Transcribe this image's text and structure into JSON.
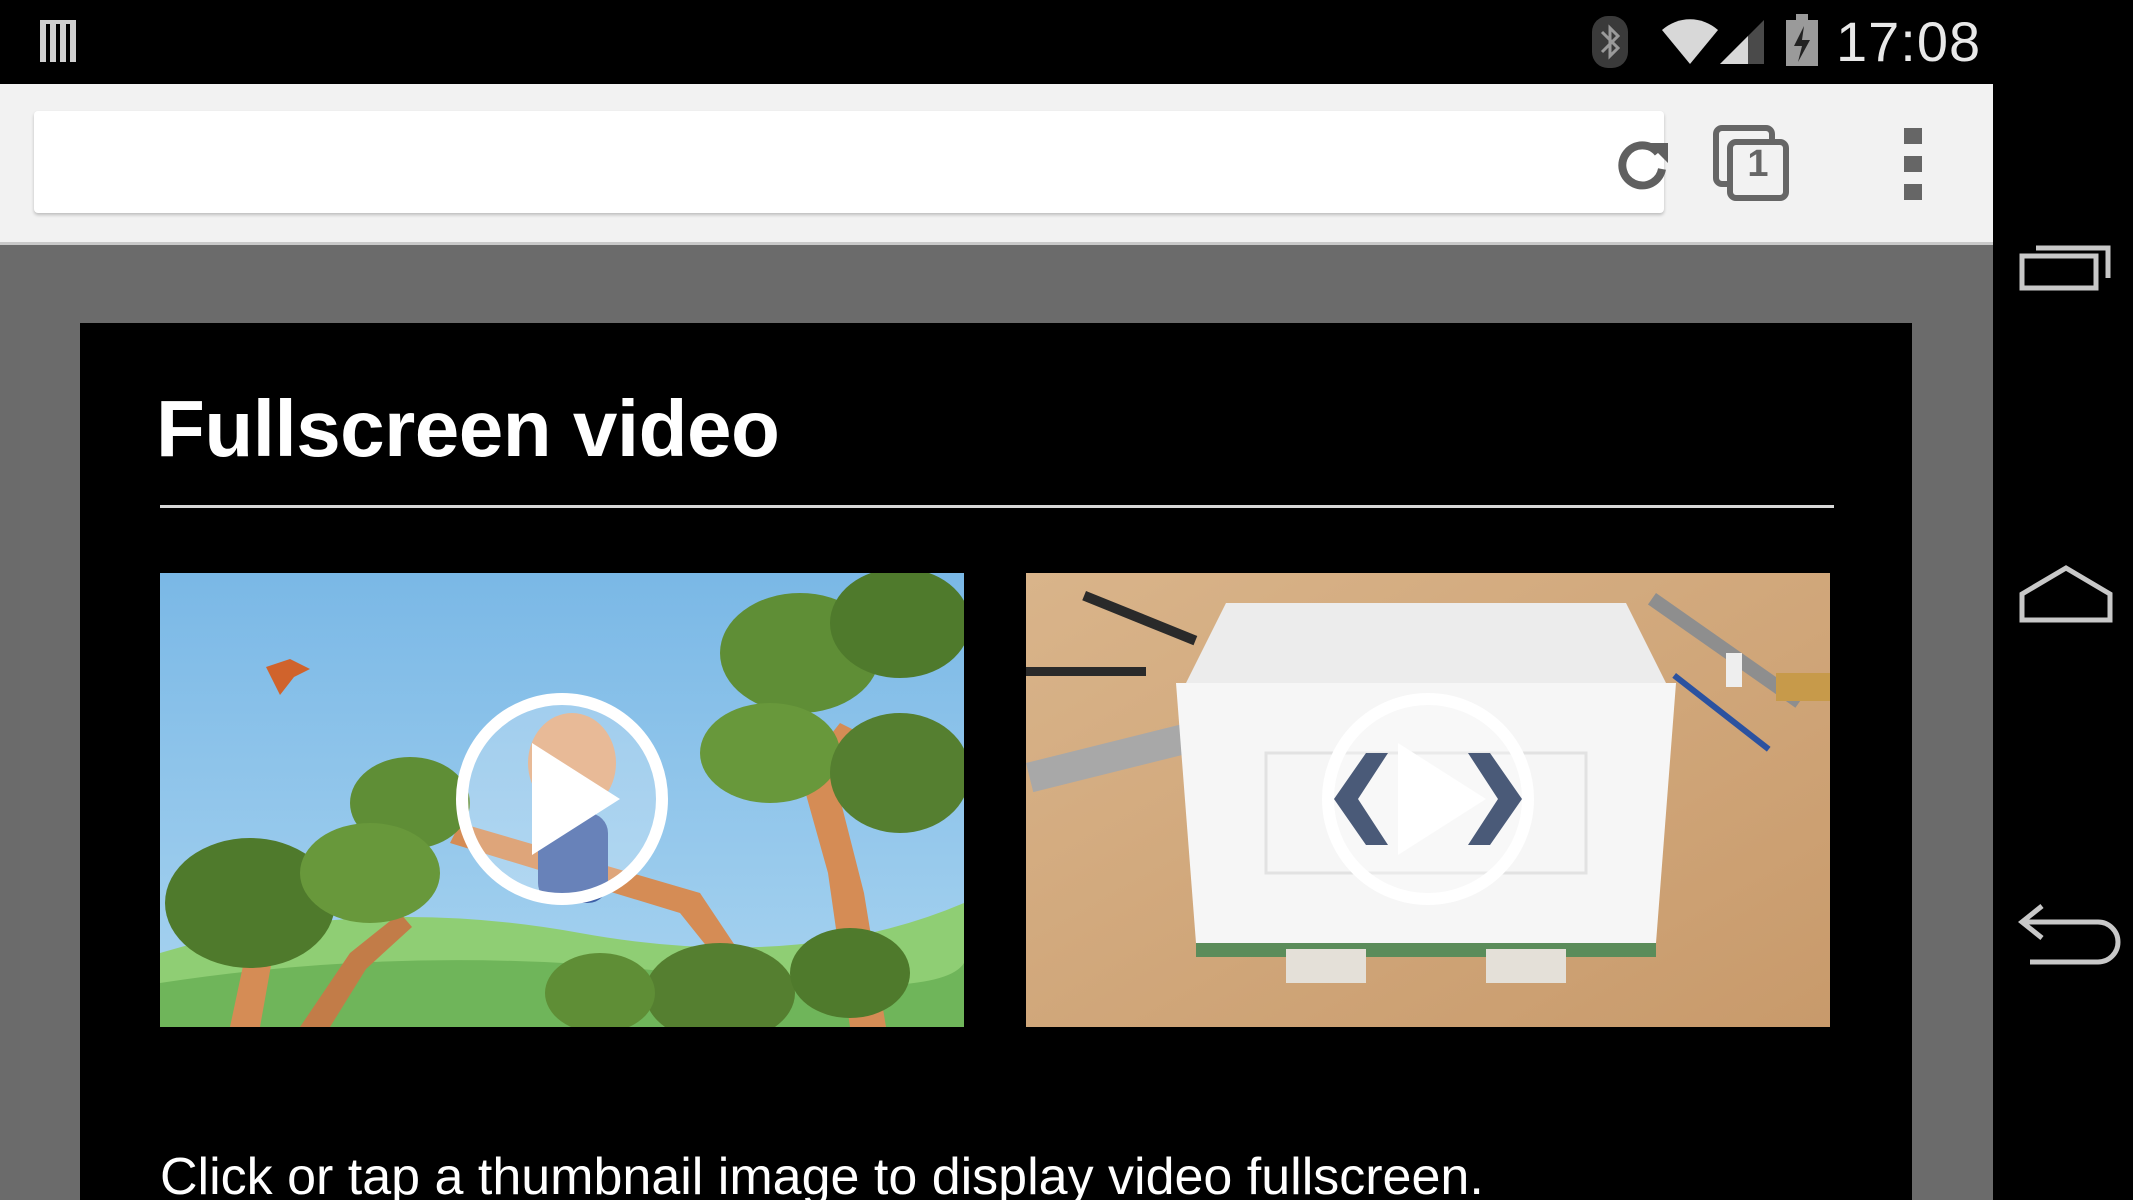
{
  "status_bar": {
    "time": "17:08",
    "icons": [
      "notification-icon",
      "bluetooth-icon",
      "wifi-icon",
      "signal-icon",
      "battery-charging-icon"
    ]
  },
  "browser": {
    "url_value": "",
    "tab_count": "1",
    "buttons": [
      "reload-icon",
      "tab-switcher-icon",
      "overflow-menu-icon"
    ]
  },
  "navigation_bar": {
    "buttons": [
      "recents-icon",
      "home-icon",
      "back-icon"
    ]
  },
  "page": {
    "title": "Fullscreen video",
    "thumbnails": [
      {
        "subject": "animated-tree-scene",
        "overlay": "play-icon"
      },
      {
        "subject": "paper-craft-table-scene",
        "overlay": "play-icon"
      }
    ],
    "caption": "Click or tap a thumbnail image to display video fullscreen."
  },
  "colors": {
    "status_bar": "#000000",
    "toolbar": "#f2f2f2",
    "viewport": "#6b6b6b",
    "page_card": "#000000",
    "text": "#ffffff"
  }
}
